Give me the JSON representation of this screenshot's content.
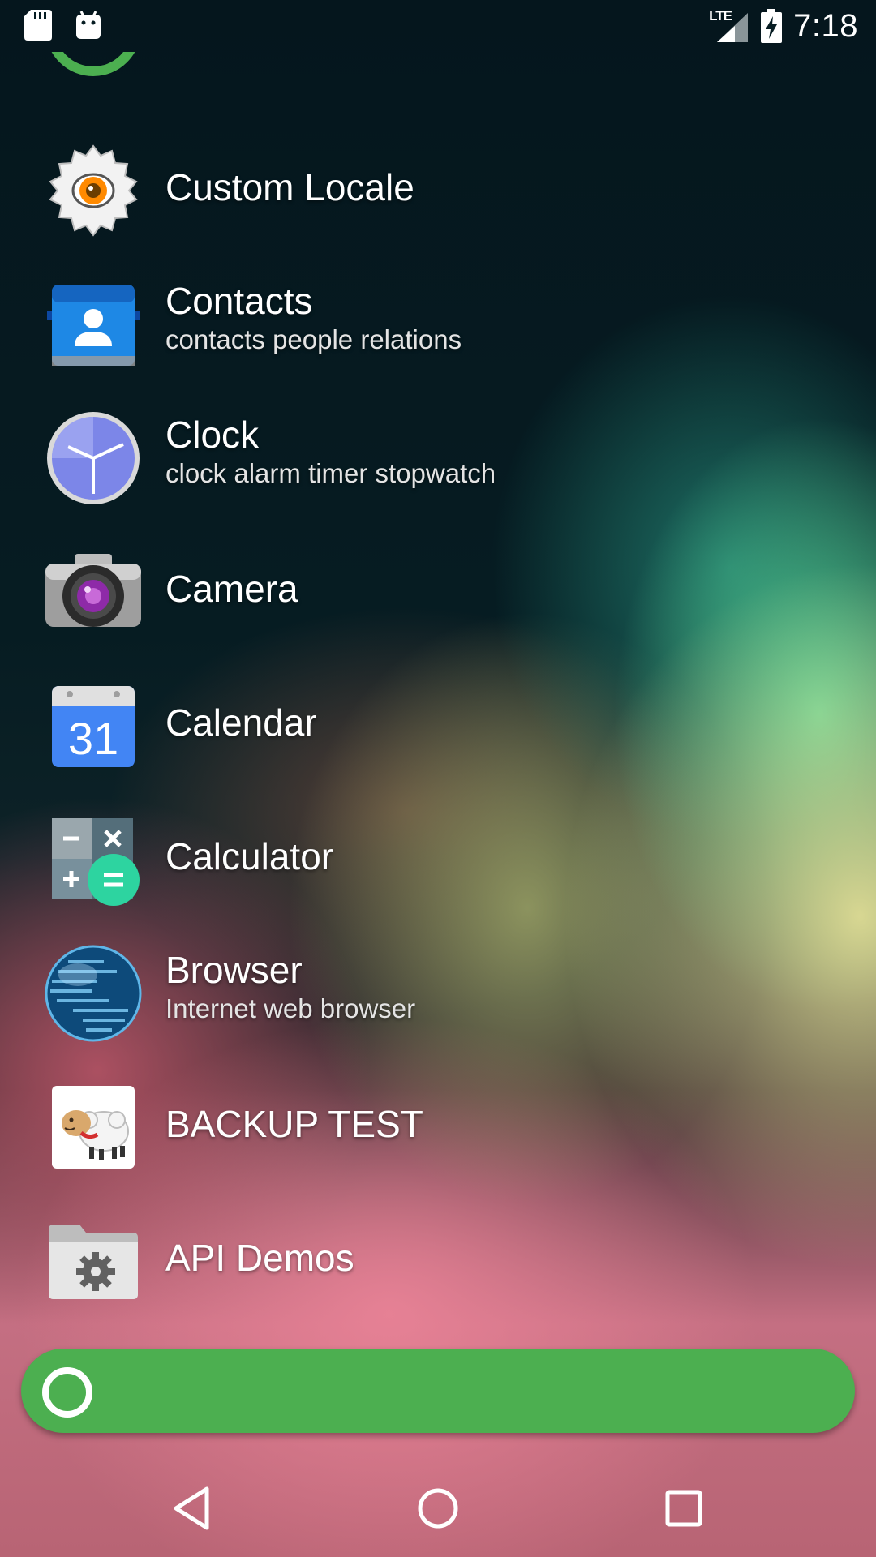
{
  "status_bar": {
    "network_label": "LTE",
    "time": "7:18",
    "icons": [
      "sd-card-icon",
      "android-debug-icon",
      "lte-signal-icon",
      "battery-charging-icon"
    ]
  },
  "apps": [
    {
      "name": "Custom Locale",
      "subtitle": "",
      "icon": "custom-locale-gear-icon"
    },
    {
      "name": "Contacts",
      "subtitle": "contacts people relations",
      "icon": "contacts-icon"
    },
    {
      "name": "Clock",
      "subtitle": "clock alarm timer stopwatch",
      "icon": "clock-icon"
    },
    {
      "name": "Camera",
      "subtitle": "",
      "icon": "camera-icon"
    },
    {
      "name": "Calendar",
      "subtitle": "",
      "icon": "calendar-icon",
      "icon_text": "31"
    },
    {
      "name": "Calculator",
      "subtitle": "",
      "icon": "calculator-icon"
    },
    {
      "name": "Browser",
      "subtitle": "Internet web browser",
      "icon": "globe-icon"
    },
    {
      "name": "BACKUP TEST",
      "subtitle": "",
      "icon": "sheep-icon"
    },
    {
      "name": "API Demos",
      "subtitle": "",
      "icon": "folder-gear-icon"
    }
  ],
  "search_bar": {
    "icon": "search-ring-icon",
    "color": "#4caf50"
  },
  "nav_bar": {
    "back": "back-icon",
    "home": "home-icon",
    "recents": "recents-icon"
  }
}
